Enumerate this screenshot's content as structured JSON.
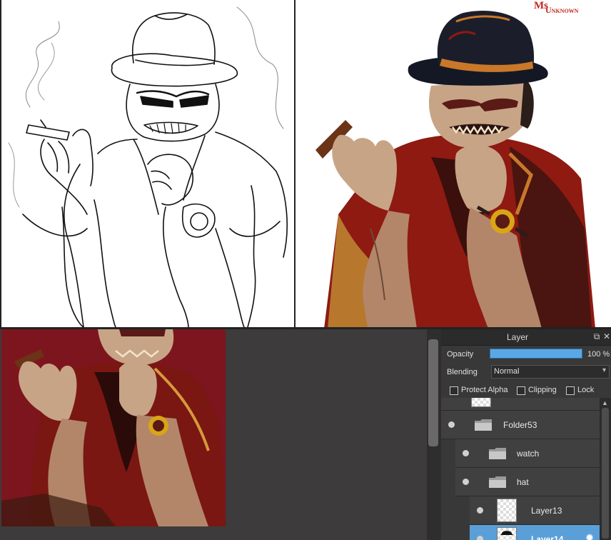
{
  "watermark": {
    "line1": "Ms",
    "line2": "Unknown"
  },
  "layer_panel": {
    "title": "Layer",
    "icons": {
      "popout": "popout-icon",
      "close": "close-icon"
    },
    "opacity": {
      "label": "Opacity",
      "value": "100 %",
      "level": 1.0
    },
    "blending": {
      "label": "Blending",
      "value": "Normal"
    },
    "options": {
      "protect_alpha": "Protect Alpha",
      "clipping": "Clipping",
      "lock": "Lock"
    },
    "layers": [
      {
        "name": "Folder53",
        "type": "folder",
        "indent": 0
      },
      {
        "name": "watch",
        "type": "folder",
        "indent": 1
      },
      {
        "name": "hat",
        "type": "folder",
        "indent": 1
      },
      {
        "name": "Layer13",
        "type": "layer",
        "indent": 2
      },
      {
        "name": "Layer14",
        "type": "layer",
        "indent": 2,
        "selected": true
      }
    ]
  },
  "colors": {
    "accent": "#5a9fd8",
    "watermark": "#c0281e",
    "shirt": "#8e1a12",
    "vest": "#3a0f0c",
    "skin": "#c8a487",
    "hat": "#1b1e2a",
    "canvas_bg": "#8c1a22"
  }
}
